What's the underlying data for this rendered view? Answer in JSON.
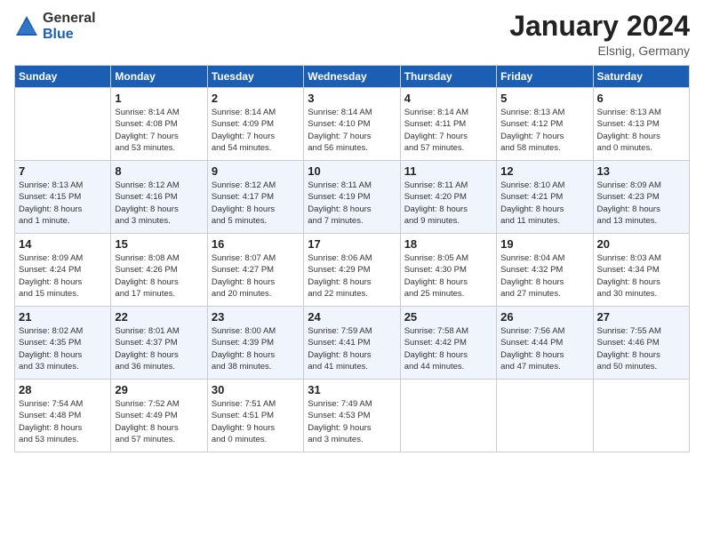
{
  "logo": {
    "general": "General",
    "blue": "Blue"
  },
  "title": "January 2024",
  "location": "Elsnig, Germany",
  "days_of_week": [
    "Sunday",
    "Monday",
    "Tuesday",
    "Wednesday",
    "Thursday",
    "Friday",
    "Saturday"
  ],
  "weeks": [
    [
      {
        "day": "",
        "info": ""
      },
      {
        "day": "1",
        "info": "Sunrise: 8:14 AM\nSunset: 4:08 PM\nDaylight: 7 hours\nand 53 minutes."
      },
      {
        "day": "2",
        "info": "Sunrise: 8:14 AM\nSunset: 4:09 PM\nDaylight: 7 hours\nand 54 minutes."
      },
      {
        "day": "3",
        "info": "Sunrise: 8:14 AM\nSunset: 4:10 PM\nDaylight: 7 hours\nand 56 minutes."
      },
      {
        "day": "4",
        "info": "Sunrise: 8:14 AM\nSunset: 4:11 PM\nDaylight: 7 hours\nand 57 minutes."
      },
      {
        "day": "5",
        "info": "Sunrise: 8:13 AM\nSunset: 4:12 PM\nDaylight: 7 hours\nand 58 minutes."
      },
      {
        "day": "6",
        "info": "Sunrise: 8:13 AM\nSunset: 4:13 PM\nDaylight: 8 hours\nand 0 minutes."
      }
    ],
    [
      {
        "day": "7",
        "info": "Sunrise: 8:13 AM\nSunset: 4:15 PM\nDaylight: 8 hours\nand 1 minute."
      },
      {
        "day": "8",
        "info": "Sunrise: 8:12 AM\nSunset: 4:16 PM\nDaylight: 8 hours\nand 3 minutes."
      },
      {
        "day": "9",
        "info": "Sunrise: 8:12 AM\nSunset: 4:17 PM\nDaylight: 8 hours\nand 5 minutes."
      },
      {
        "day": "10",
        "info": "Sunrise: 8:11 AM\nSunset: 4:19 PM\nDaylight: 8 hours\nand 7 minutes."
      },
      {
        "day": "11",
        "info": "Sunrise: 8:11 AM\nSunset: 4:20 PM\nDaylight: 8 hours\nand 9 minutes."
      },
      {
        "day": "12",
        "info": "Sunrise: 8:10 AM\nSunset: 4:21 PM\nDaylight: 8 hours\nand 11 minutes."
      },
      {
        "day": "13",
        "info": "Sunrise: 8:09 AM\nSunset: 4:23 PM\nDaylight: 8 hours\nand 13 minutes."
      }
    ],
    [
      {
        "day": "14",
        "info": "Sunrise: 8:09 AM\nSunset: 4:24 PM\nDaylight: 8 hours\nand 15 minutes."
      },
      {
        "day": "15",
        "info": "Sunrise: 8:08 AM\nSunset: 4:26 PM\nDaylight: 8 hours\nand 17 minutes."
      },
      {
        "day": "16",
        "info": "Sunrise: 8:07 AM\nSunset: 4:27 PM\nDaylight: 8 hours\nand 20 minutes."
      },
      {
        "day": "17",
        "info": "Sunrise: 8:06 AM\nSunset: 4:29 PM\nDaylight: 8 hours\nand 22 minutes."
      },
      {
        "day": "18",
        "info": "Sunrise: 8:05 AM\nSunset: 4:30 PM\nDaylight: 8 hours\nand 25 minutes."
      },
      {
        "day": "19",
        "info": "Sunrise: 8:04 AM\nSunset: 4:32 PM\nDaylight: 8 hours\nand 27 minutes."
      },
      {
        "day": "20",
        "info": "Sunrise: 8:03 AM\nSunset: 4:34 PM\nDaylight: 8 hours\nand 30 minutes."
      }
    ],
    [
      {
        "day": "21",
        "info": "Sunrise: 8:02 AM\nSunset: 4:35 PM\nDaylight: 8 hours\nand 33 minutes."
      },
      {
        "day": "22",
        "info": "Sunrise: 8:01 AM\nSunset: 4:37 PM\nDaylight: 8 hours\nand 36 minutes."
      },
      {
        "day": "23",
        "info": "Sunrise: 8:00 AM\nSunset: 4:39 PM\nDaylight: 8 hours\nand 38 minutes."
      },
      {
        "day": "24",
        "info": "Sunrise: 7:59 AM\nSunset: 4:41 PM\nDaylight: 8 hours\nand 41 minutes."
      },
      {
        "day": "25",
        "info": "Sunrise: 7:58 AM\nSunset: 4:42 PM\nDaylight: 8 hours\nand 44 minutes."
      },
      {
        "day": "26",
        "info": "Sunrise: 7:56 AM\nSunset: 4:44 PM\nDaylight: 8 hours\nand 47 minutes."
      },
      {
        "day": "27",
        "info": "Sunrise: 7:55 AM\nSunset: 4:46 PM\nDaylight: 8 hours\nand 50 minutes."
      }
    ],
    [
      {
        "day": "28",
        "info": "Sunrise: 7:54 AM\nSunset: 4:48 PM\nDaylight: 8 hours\nand 53 minutes."
      },
      {
        "day": "29",
        "info": "Sunrise: 7:52 AM\nSunset: 4:49 PM\nDaylight: 8 hours\nand 57 minutes."
      },
      {
        "day": "30",
        "info": "Sunrise: 7:51 AM\nSunset: 4:51 PM\nDaylight: 9 hours\nand 0 minutes."
      },
      {
        "day": "31",
        "info": "Sunrise: 7:49 AM\nSunset: 4:53 PM\nDaylight: 9 hours\nand 3 minutes."
      },
      {
        "day": "",
        "info": ""
      },
      {
        "day": "",
        "info": ""
      },
      {
        "day": "",
        "info": ""
      }
    ]
  ]
}
